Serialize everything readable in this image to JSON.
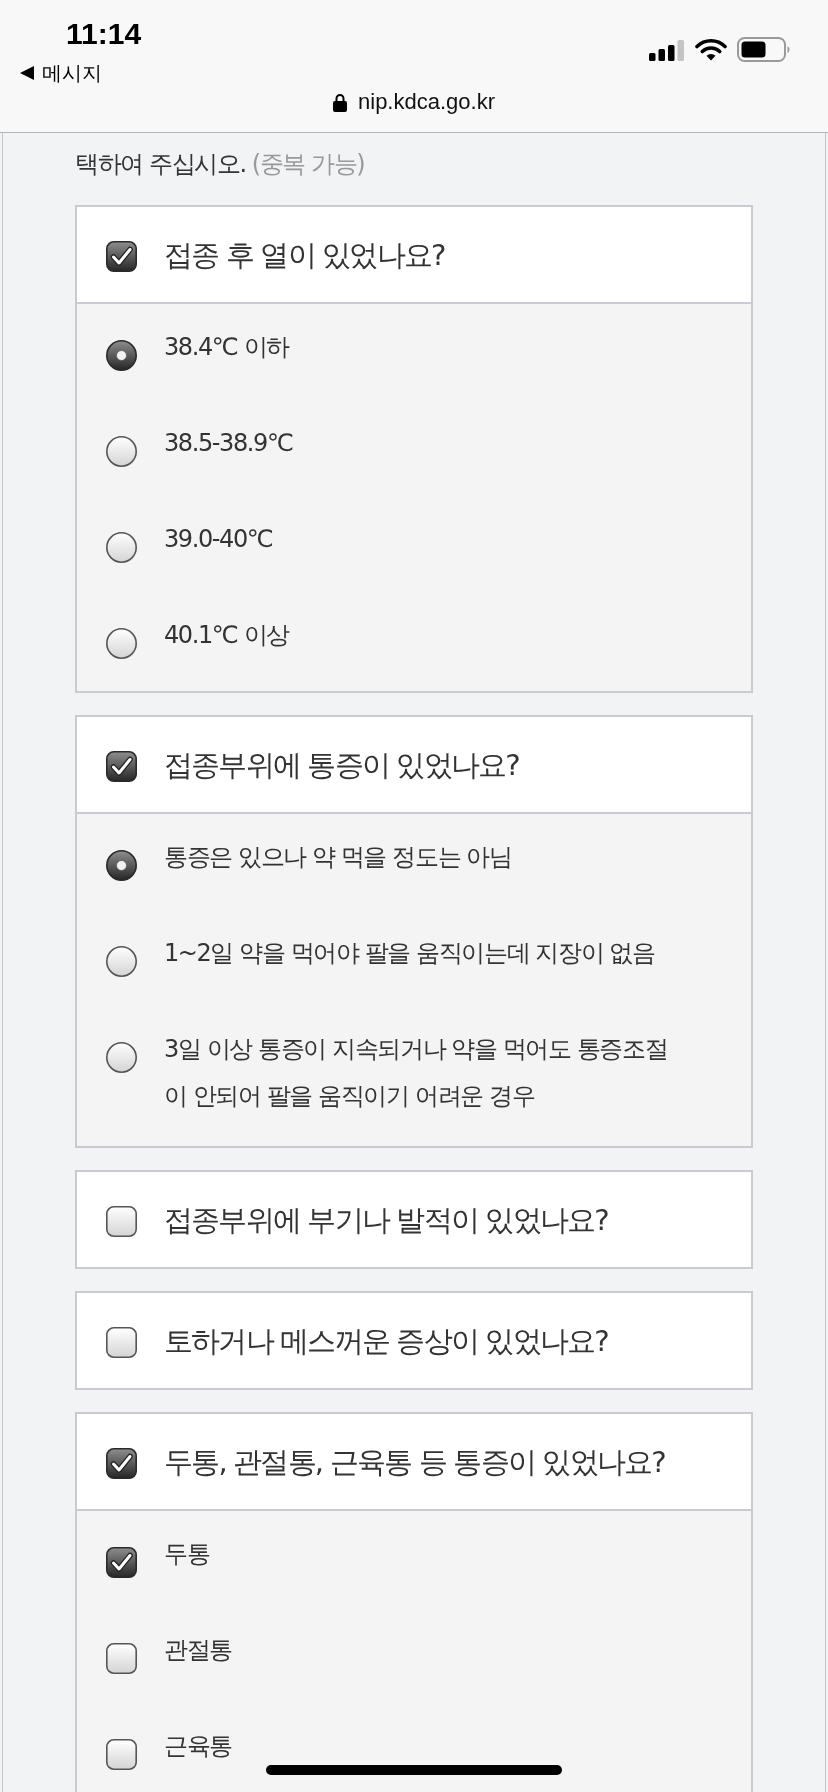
{
  "status_bar": {
    "time": "11:14",
    "back_label": "메시지",
    "url": "nip.kdca.go.kr"
  },
  "instruction": {
    "text": "택하여 주십시오.",
    "note": "(중복 가능)"
  },
  "questions": [
    {
      "label": "접종 후 열이 있었나요?",
      "checked": true,
      "options": [
        {
          "kind": "radio",
          "label": "38.4℃ 이하",
          "selected": true
        },
        {
          "kind": "radio",
          "label": "38.5-38.9℃",
          "selected": false
        },
        {
          "kind": "radio",
          "label": "39.0-40℃",
          "selected": false
        },
        {
          "kind": "radio",
          "label": "40.1℃ 이상",
          "selected": false
        }
      ]
    },
    {
      "label": "접종부위에 통증이 있었나요?",
      "checked": true,
      "options": [
        {
          "kind": "radio",
          "label": "통증은 있으나 약 먹을 정도는 아님",
          "selected": true
        },
        {
          "kind": "radio",
          "label": "1~2일 약을 먹어야 팔을 움직이는데 지장이 없음",
          "selected": false
        },
        {
          "kind": "radio",
          "label": "3일 이상 통증이 지속되거나 약을 먹어도 통증조절이 안되어 팔을 움직이기 어려운 경우",
          "selected": false
        }
      ]
    },
    {
      "label": "접종부위에 부기나 발적이 있었나요?",
      "checked": false
    },
    {
      "label": "토하거나 메스꺼운 증상이 있었나요?",
      "checked": false
    },
    {
      "label": "두통, 관절통, 근육통 등 통증이 있었나요?",
      "checked": true,
      "options": [
        {
          "kind": "checkbox",
          "label": "두통",
          "checked": true
        },
        {
          "kind": "checkbox",
          "label": "관절통",
          "checked": false
        },
        {
          "kind": "checkbox",
          "label": "근육통",
          "checked": false
        }
      ]
    }
  ]
}
